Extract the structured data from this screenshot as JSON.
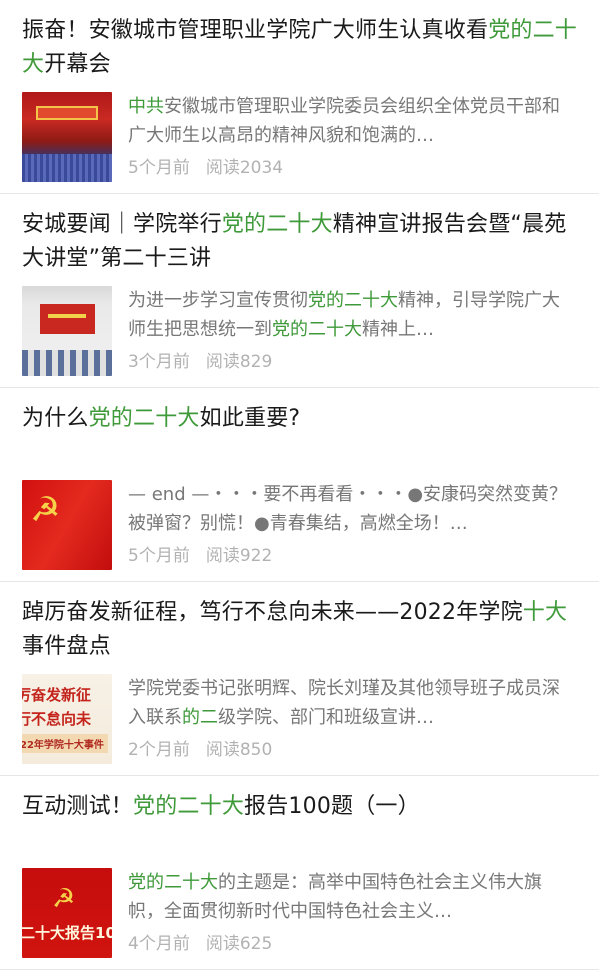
{
  "articles": [
    {
      "title_parts": [
        "振奋！安徽城市管理职业学院广大师生认真收看",
        "党的二十大",
        "开幕会"
      ],
      "summary_parts": [
        "中共",
        "安徽城市管理职业学院委员会组织全体党员干部和广大师生以高昂的精神风貌和饱满的…"
      ],
      "time": "5个月前",
      "reads": "阅读2034"
    },
    {
      "title_parts": [
        "安城要闻｜学院举行",
        "党的二十大",
        "精神宣讲报告会暨“晨苑大讲堂”第二十三讲"
      ],
      "summary_parts": [
        "为进一步学习宣传贯彻",
        "党的二十大",
        "精神，引导学院广大师生把思想统一到",
        "党的二十大",
        "精神上…"
      ],
      "time": "3个月前",
      "reads": "阅读829"
    },
    {
      "title_parts": [
        "为什么",
        "党的二十大",
        "如此重要?"
      ],
      "summary_parts": [
        "— end —・・・要不再看看・・・●安康码突然变黄？被弹窗？别慌！●青春集结，高燃全场！…"
      ],
      "time": "5个月前",
      "reads": "阅读922"
    },
    {
      "title_parts": [
        "踔厉奋发新征程，笃行不怠向未来——2022年学院",
        "十大",
        "事件盘点"
      ],
      "summary_parts": [
        "学院党委书记张明辉、院长刘瑾及其他领导班子成员深入联系",
        "的二",
        "级学院、部门和班级宣讲…"
      ],
      "time": "2个月前",
      "reads": "阅读850"
    },
    {
      "title_parts": [
        "互动测试！",
        "党的二十大",
        "报告100题（一）"
      ],
      "summary_parts": [
        "党的二十大",
        "的主题是：高举中国特色社会主义伟大旗帜，全面贯彻新时代中国特色社会主义…"
      ],
      "time": "4个月前",
      "reads": "阅读625"
    }
  ],
  "thumbnails": {
    "t4_line1": "厉奋发新征",
    "t4_line2": "行不怠向未",
    "t4_line3": "22年学院十大事件",
    "t5_text": "二十大报告10"
  },
  "colors": {
    "highlight": "#3f9a3a",
    "meta": "#b2b2b2",
    "summary": "#777777"
  }
}
